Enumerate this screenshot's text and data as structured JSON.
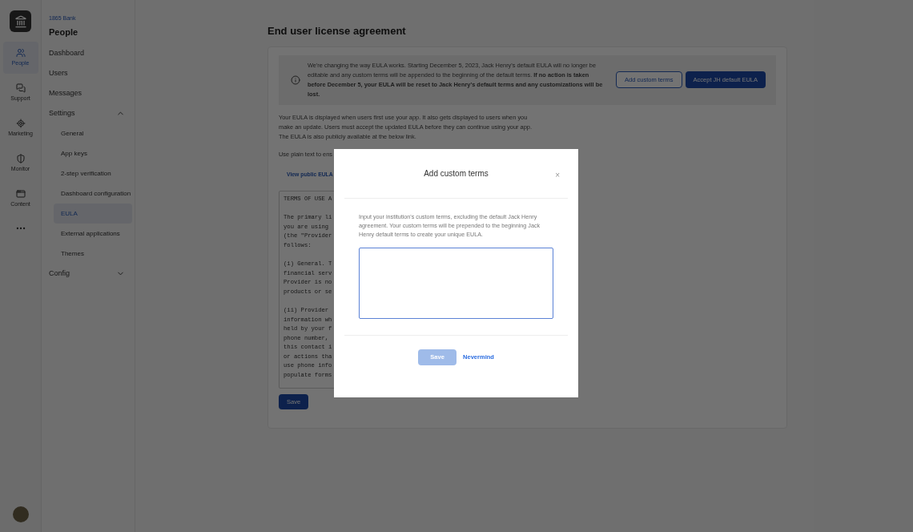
{
  "rail": {
    "items": [
      {
        "label": "People",
        "selected": true
      },
      {
        "label": "Support",
        "selected": false
      },
      {
        "label": "Marketing",
        "selected": false
      },
      {
        "label": "Monitor",
        "selected": false
      },
      {
        "label": "Content",
        "selected": false
      }
    ]
  },
  "nav": {
    "org": "1865 Bank",
    "title": "People",
    "items": [
      {
        "label": "Dashboard",
        "selected": false
      },
      {
        "label": "Users",
        "selected": false
      },
      {
        "label": "Messages",
        "selected": false
      },
      {
        "label": "Settings",
        "selected": false,
        "expanded": true,
        "children": [
          {
            "label": "General",
            "selected": false
          },
          {
            "label": "App keys",
            "selected": false
          },
          {
            "label": "2-step verification",
            "selected": false
          },
          {
            "label": "Dashboard configuration",
            "selected": false
          },
          {
            "label": "EULA",
            "selected": true
          },
          {
            "label": "External applications",
            "selected": false
          },
          {
            "label": "Themes",
            "selected": false
          }
        ]
      },
      {
        "label": "Config",
        "selected": false,
        "expanded": false
      }
    ]
  },
  "page": {
    "title": "End user license agreement",
    "banner": {
      "text": "We're changing the way EULA works. Starting December 5, 2023, Jack Henry's default EULA will no longer be editable and any custom terms will be appended to the beginning of the default terms. **If no action is taken before December 5, your EULA will be reset to Jack Henry's default terms and any customizations will be lost.**",
      "buttons": [
        "Add custom terms",
        "Accept JH default EULA"
      ]
    },
    "intro": "Your EULA is displayed when users first use your app. It also gets displayed to users when you make an update. Users must accept the updated EULA before they can continue using your app. The EULA is also publicly available at the below link.",
    "hint": "Use plain text to ens",
    "link": "View public EULA",
    "eula_paragraphs": [
      [
        "TERMS OF USE A"
      ],
      [
        "The primary li",
        "you are using",
        "(the \"Provider",
        "follows:"
      ],
      [
        "(i) General. T",
        "financial serv",
        "Provider is no",
        "products or se"
      ],
      [
        "(ii) Provider",
        "information wh",
        "held by your f",
        "phone number,",
        "this contact i",
        "or actions tha",
        "use phone info",
        "populate forms"
      ]
    ],
    "save": "Save"
  },
  "dialog": {
    "title": "Add custom terms",
    "close": "×",
    "text": "Input your institution's custom terms, excluding the default Jack Henry agreement. Your custom terms will be prepended to the beginning Jack Henry default terms to create your unique EULA.",
    "save": {
      "label": "Save",
      "disabled": true
    },
    "cancel": "Nevermind"
  }
}
